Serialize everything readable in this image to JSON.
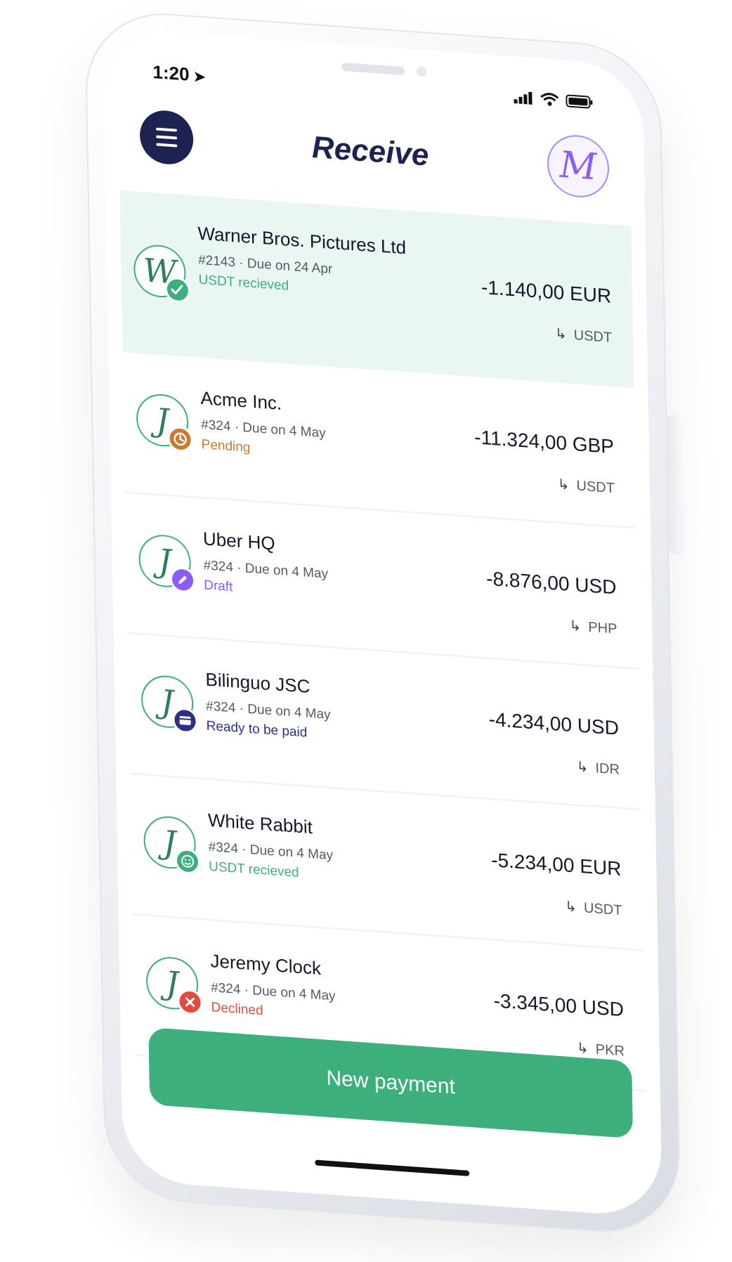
{
  "status_bar": {
    "time": "1:20",
    "location_arrow": "➤"
  },
  "header": {
    "title": "Receive",
    "avatar_initial": "M",
    "menu_icon": "hamburger-icon"
  },
  "colors": {
    "navy": "#1e2251",
    "green": "#3daf7d",
    "highlight_bg": "#eaf6f1",
    "pending": "#c77b2e",
    "draft": "#8b5cf6",
    "ready": "#2b2f8a",
    "declined": "#e24c3f"
  },
  "payments": [
    {
      "initial": "W",
      "name": "Warner Bros. Pictures Ltd",
      "meta": "#2143 · Due on 24 Apr",
      "status": "USDT recieved",
      "status_icon": "check-icon",
      "status_color": "#3daf7d",
      "amount": "-1.140,00 EUR",
      "target": "USDT",
      "highlight": true
    },
    {
      "initial": "J",
      "name": "Acme Inc.",
      "meta": "#324 · Due on 4 May",
      "status": "Pending",
      "status_icon": "clock-icon",
      "status_color": "#c77b2e",
      "amount": "-11.324,00 GBP",
      "target": "USDT",
      "highlight": false
    },
    {
      "initial": "J",
      "name": "Uber HQ",
      "meta": "#324 · Due on 4 May",
      "status": "Draft",
      "status_icon": "pencil-icon",
      "status_color": "#8b5cf6",
      "amount": "-8.876,00 USD",
      "target": "PHP",
      "highlight": false
    },
    {
      "initial": "J",
      "name": "Bilinguo JSC",
      "meta": "#324 · Due on 4 May",
      "status": "Ready to be paid",
      "status_icon": "card-icon",
      "status_color": "#2b2f8a",
      "amount": "-4.234,00 USD",
      "target": "IDR",
      "highlight": false
    },
    {
      "initial": "J",
      "name": "White Rabbit",
      "meta": "#324 · Due on 4 May",
      "status": "USDT recieved",
      "status_icon": "smile-icon",
      "status_color": "#3daf7d",
      "amount": "-5.234,00 EUR",
      "target": "USDT",
      "highlight": false
    },
    {
      "initial": "J",
      "name": "Jeremy Clock",
      "meta": "#324 · Due on 4 May",
      "status": "Declined",
      "status_icon": "x-icon",
      "status_color": "#e24c3f",
      "amount": "-3.345,00 USD",
      "target": "PKR",
      "highlight": false
    }
  ],
  "cta": {
    "label": "New payment"
  }
}
